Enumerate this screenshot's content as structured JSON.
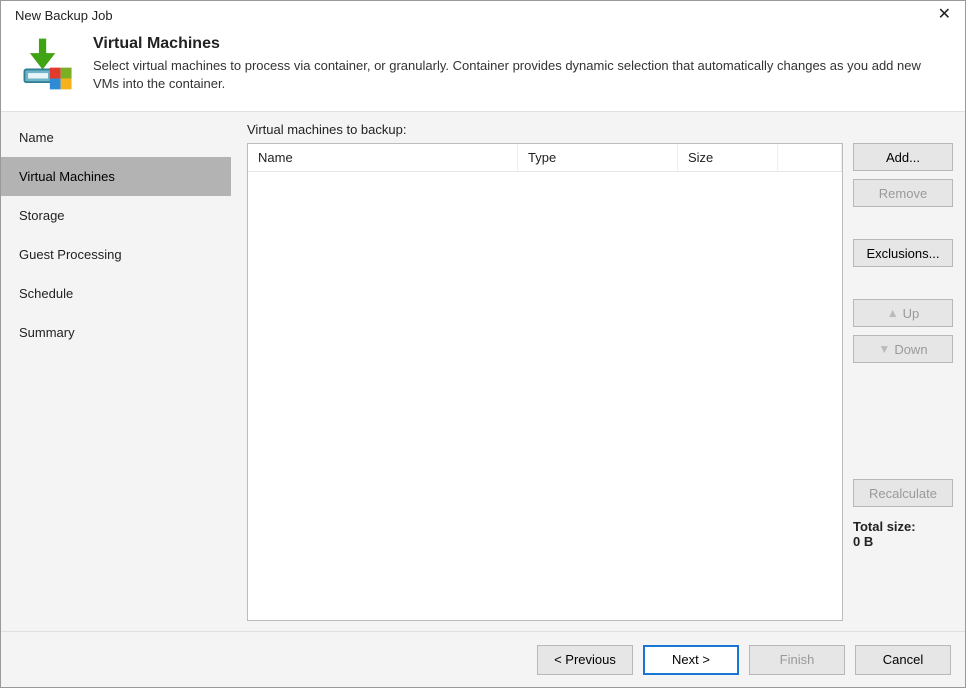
{
  "window": {
    "title": "New Backup Job"
  },
  "header": {
    "title": "Virtual Machines",
    "description": "Select virtual machines to process via container, or granularly. Container provides dynamic selection that automatically changes as you add new VMs into the container."
  },
  "sidebar": {
    "items": [
      {
        "label": "Name"
      },
      {
        "label": "Virtual Machines"
      },
      {
        "label": "Storage"
      },
      {
        "label": "Guest Processing"
      },
      {
        "label": "Schedule"
      },
      {
        "label": "Summary"
      }
    ],
    "selectedIndex": 1
  },
  "main": {
    "list_label": "Virtual machines to backup:",
    "columns": {
      "name": "Name",
      "type": "Type",
      "size": "Size"
    },
    "rows": []
  },
  "buttons": {
    "add": "Add...",
    "remove": "Remove",
    "exclusions": "Exclusions...",
    "up": "Up",
    "down": "Down",
    "recalculate": "Recalculate"
  },
  "total": {
    "label": "Total size:",
    "value": "0 B"
  },
  "footer": {
    "previous": "< Previous",
    "next": "Next >",
    "finish": "Finish",
    "cancel": "Cancel"
  }
}
